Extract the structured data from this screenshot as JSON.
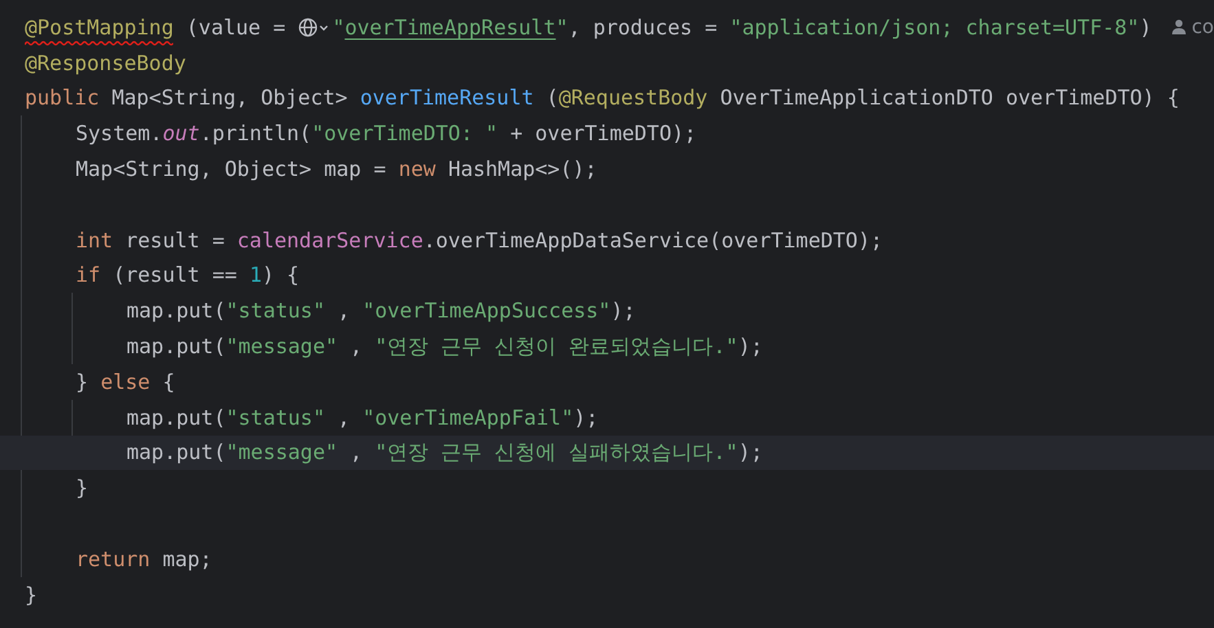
{
  "editor": {
    "lines": [
      {
        "current": false,
        "tokens": [
          {
            "kind": "annotation",
            "text": "@PostMapping",
            "error": true
          },
          {
            "kind": "plain",
            "text": " (value = "
          },
          {
            "kind": "globe"
          },
          {
            "kind": "string",
            "text": "\""
          },
          {
            "kind": "link",
            "text": "overTimeAppResult"
          },
          {
            "kind": "string",
            "text": "\""
          },
          {
            "kind": "plain",
            "text": ", produces = "
          },
          {
            "kind": "string",
            "text": "\"application/json; charset=UTF-8\""
          },
          {
            "kind": "plain",
            "text": ")"
          }
        ],
        "hint": "co"
      },
      {
        "current": false,
        "tokens": [
          {
            "kind": "annotation",
            "text": "@ResponseBody"
          }
        ]
      },
      {
        "current": false,
        "tokens": [
          {
            "kind": "keyword",
            "text": "public "
          },
          {
            "kind": "plain",
            "text": "Map<String, Object> "
          },
          {
            "kind": "method",
            "text": "overTimeResult"
          },
          {
            "kind": "plain",
            "text": " ("
          },
          {
            "kind": "annotation",
            "text": "@RequestBody"
          },
          {
            "kind": "plain",
            "text": " OverTimeApplicationDTO overTimeDTO) {"
          }
        ],
        "children": [
          {
            "current": false,
            "tokens": [
              {
                "kind": "plain",
                "text": "System."
              },
              {
                "kind": "static",
                "text": "out"
              },
              {
                "kind": "plain",
                "text": ".println("
              },
              {
                "kind": "string",
                "text": "\"overTimeDTO: \""
              },
              {
                "kind": "plain",
                "text": " + overTimeDTO);"
              }
            ]
          },
          {
            "current": false,
            "tokens": [
              {
                "kind": "plain",
                "text": "Map<String, Object> map = "
              },
              {
                "kind": "keyword",
                "text": "new "
              },
              {
                "kind": "plain",
                "text": "HashMap<>();"
              }
            ]
          },
          {
            "current": false
          },
          {
            "current": false,
            "tokens": [
              {
                "kind": "keyword",
                "text": "int "
              },
              {
                "kind": "plain",
                "text": "result = "
              },
              {
                "kind": "field",
                "text": "calendarService"
              },
              {
                "kind": "plain",
                "text": ".overTimeAppDataService(overTimeDTO);"
              }
            ]
          },
          {
            "current": false,
            "tokens": [
              {
                "kind": "keyword",
                "text": "if "
              },
              {
                "kind": "plain",
                "text": "(result == "
              },
              {
                "kind": "number",
                "text": "1"
              },
              {
                "kind": "plain",
                "text": ") {"
              }
            ],
            "children": [
              {
                "current": false,
                "tokens": [
                  {
                    "kind": "plain",
                    "text": "map.put("
                  },
                  {
                    "kind": "string",
                    "text": "\"status\""
                  },
                  {
                    "kind": "plain",
                    "text": " , "
                  },
                  {
                    "kind": "string",
                    "text": "\"overTimeAppSuccess\""
                  },
                  {
                    "kind": "plain",
                    "text": ");"
                  }
                ]
              },
              {
                "current": false,
                "tokens": [
                  {
                    "kind": "plain",
                    "text": "map.put("
                  },
                  {
                    "kind": "string",
                    "text": "\"message\""
                  },
                  {
                    "kind": "plain",
                    "text": " , "
                  },
                  {
                    "kind": "string",
                    "text": "\"연장 근무 신청이 완료되었습니다.\""
                  },
                  {
                    "kind": "plain",
                    "text": ");"
                  }
                ]
              }
            ]
          },
          {
            "current": false,
            "tokens": [
              {
                "kind": "plain",
                "text": "} "
              },
              {
                "kind": "keyword",
                "text": "else "
              },
              {
                "kind": "plain",
                "text": "{"
              }
            ],
            "children": [
              {
                "current": false,
                "tokens": [
                  {
                    "kind": "plain",
                    "text": "map.put("
                  },
                  {
                    "kind": "string",
                    "text": "\"status\""
                  },
                  {
                    "kind": "plain",
                    "text": " , "
                  },
                  {
                    "kind": "string",
                    "text": "\"overTimeAppFail\""
                  },
                  {
                    "kind": "plain",
                    "text": ");"
                  }
                ]
              },
              {
                "current": true,
                "tokens": [
                  {
                    "kind": "plain",
                    "text": "map.put("
                  },
                  {
                    "kind": "string",
                    "text": "\"message\""
                  },
                  {
                    "kind": "plain",
                    "text": " , "
                  },
                  {
                    "kind": "string",
                    "text": "\"연장 근무 신청에 실패하였습니다.\""
                  },
                  {
                    "kind": "plain",
                    "text": ");"
                  }
                ]
              }
            ]
          },
          {
            "current": false,
            "tokens": [
              {
                "kind": "plain",
                "text": "}"
              }
            ]
          },
          {
            "current": false
          },
          {
            "current": false,
            "tokens": [
              {
                "kind": "keyword",
                "text": "return "
              },
              {
                "kind": "plain",
                "text": "map;"
              }
            ]
          }
        ]
      },
      {
        "current": false,
        "tokens": [
          {
            "kind": "plain",
            "text": "}"
          }
        ]
      }
    ]
  }
}
